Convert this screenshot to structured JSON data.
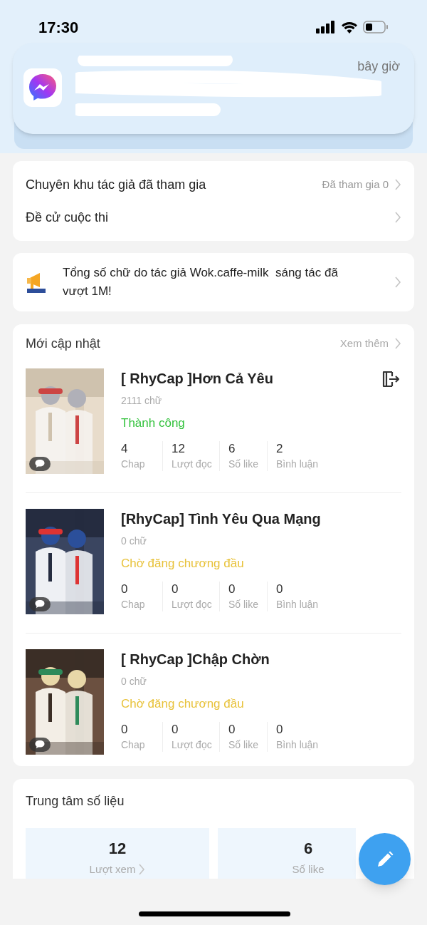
{
  "status_bar": {
    "time": "17:30"
  },
  "notification": {
    "time": "bây giờ"
  },
  "menu": [
    {
      "label": "Chuyên khu tác giả đã tham gia",
      "value": "Đã tham gia 0"
    },
    {
      "label": "Đề cử cuộc thi"
    }
  ],
  "announcement": {
    "text": "Tổng số chữ do tác giả Wok.caffe-milk  sáng tác đã vượt 1M!"
  },
  "updates": {
    "title": "Mới cập nhật",
    "more": "Xem thêm",
    "books": [
      {
        "title": "[ RhyCap ]Hơn Cả Yêu",
        "words": "2111 chữ",
        "status": "Thành công",
        "kind": "success",
        "exit_icon": true,
        "stats": [
          {
            "value": "4",
            "label": "Chap"
          },
          {
            "value": "12",
            "label": "Lượt đọc"
          },
          {
            "value": "6",
            "label": "Số like"
          },
          {
            "value": "2",
            "label": "Bình luận"
          }
        ]
      },
      {
        "title": "[RhyCap] Tình Yêu Qua Mạng",
        "words": "0 chữ",
        "status": "Chờ đăng chương đầu",
        "kind": "pending",
        "exit_icon": false,
        "stats": [
          {
            "value": "0",
            "label": "Chap"
          },
          {
            "value": "0",
            "label": "Lượt đọc"
          },
          {
            "value": "0",
            "label": "Số like"
          },
          {
            "value": "0",
            "label": "Bình luận"
          }
        ]
      },
      {
        "title": "[ RhyCap ]Chập Chờn",
        "words": "0 chữ",
        "status": "Chờ đăng chương đầu",
        "kind": "pending",
        "exit_icon": false,
        "stats": [
          {
            "value": "0",
            "label": "Chap"
          },
          {
            "value": "0",
            "label": "Lượt đọc"
          },
          {
            "value": "0",
            "label": "Số like"
          },
          {
            "value": "0",
            "label": "Bình luận"
          }
        ]
      }
    ]
  },
  "data_center": {
    "title": "Trung tâm số liệu",
    "tiles": [
      {
        "value": "12",
        "label": "Lượt xem",
        "link": true
      },
      {
        "value": "6",
        "label": "Số like",
        "link": false
      }
    ]
  }
}
